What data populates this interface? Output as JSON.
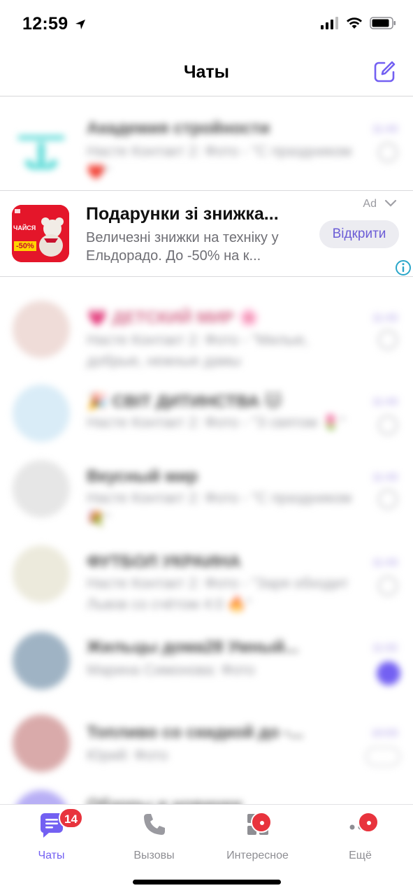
{
  "status": {
    "time": "12:59"
  },
  "header": {
    "title": "Чаты"
  },
  "chats": [
    {
      "title": "Академия стройности",
      "preview": "Насте Контакт 2: Фото - \"С праздником ❤️\"",
      "time": "11:43",
      "avatar_color": "#4dd8d4"
    },
    {
      "title": "💗 ДЕТСКИЙ МИР 🌸",
      "preview": "Насте Контакт 2: Фото - \"Милые, добрые, нежные дамы",
      "time": "11:43",
      "avatar_color": "#e8c9c4"
    },
    {
      "title": "🎉 СВІТ ДИТИНСТВА 🐱",
      "preview": "Насте Контакт 2: Фото - \"З святом 🌷\"",
      "time": "11:43",
      "avatar_color": "#9cc7e8"
    },
    {
      "title": "Вкусный мир",
      "preview": "Насте Контакт 2: Фото - \"С праздником 💐\"",
      "time": "11:43",
      "avatar_color": "#c9c9c9"
    },
    {
      "title": "ФУТБОЛ УКРАИНА",
      "preview": "Насте Контакт 2: Фото - \"Заря обходит Львов со счётом 4:0 🔥\"",
      "time": "11:43",
      "avatar_color": "#c9c37a"
    },
    {
      "title": "Жильцы дома28 Умный...",
      "preview": "Марина Симонова: Фото",
      "time": "11:02",
      "avatar_color": "#8aa2b8"
    },
    {
      "title": "Топливо со скидкой до -...",
      "preview": "Юрий: Фото",
      "time": "10:03",
      "avatar_color": "#c47a7a"
    },
    {
      "title": "Обзоры и новинки",
      "preview": "",
      "time": "",
      "avatar_color": "#9b8ef2"
    }
  ],
  "ad": {
    "title": "Подарунки зі знижка...",
    "text": "Величезні знижки на техніку у Ельдорадо. До -50% на к...",
    "label": "Ad",
    "open_button": "Відкрити",
    "image_caption": "ЧАЙСЯ",
    "image_discount": "-50%",
    "accent_color": "#e4162a"
  },
  "tabs": [
    {
      "label": "Чаты",
      "badge": "14",
      "active": true
    },
    {
      "label": "Вызовы"
    },
    {
      "label": "Интересное"
    },
    {
      "label": "Ещё"
    }
  ],
  "colors": {
    "brand": "#7360f2",
    "badge": "#e8333d"
  }
}
